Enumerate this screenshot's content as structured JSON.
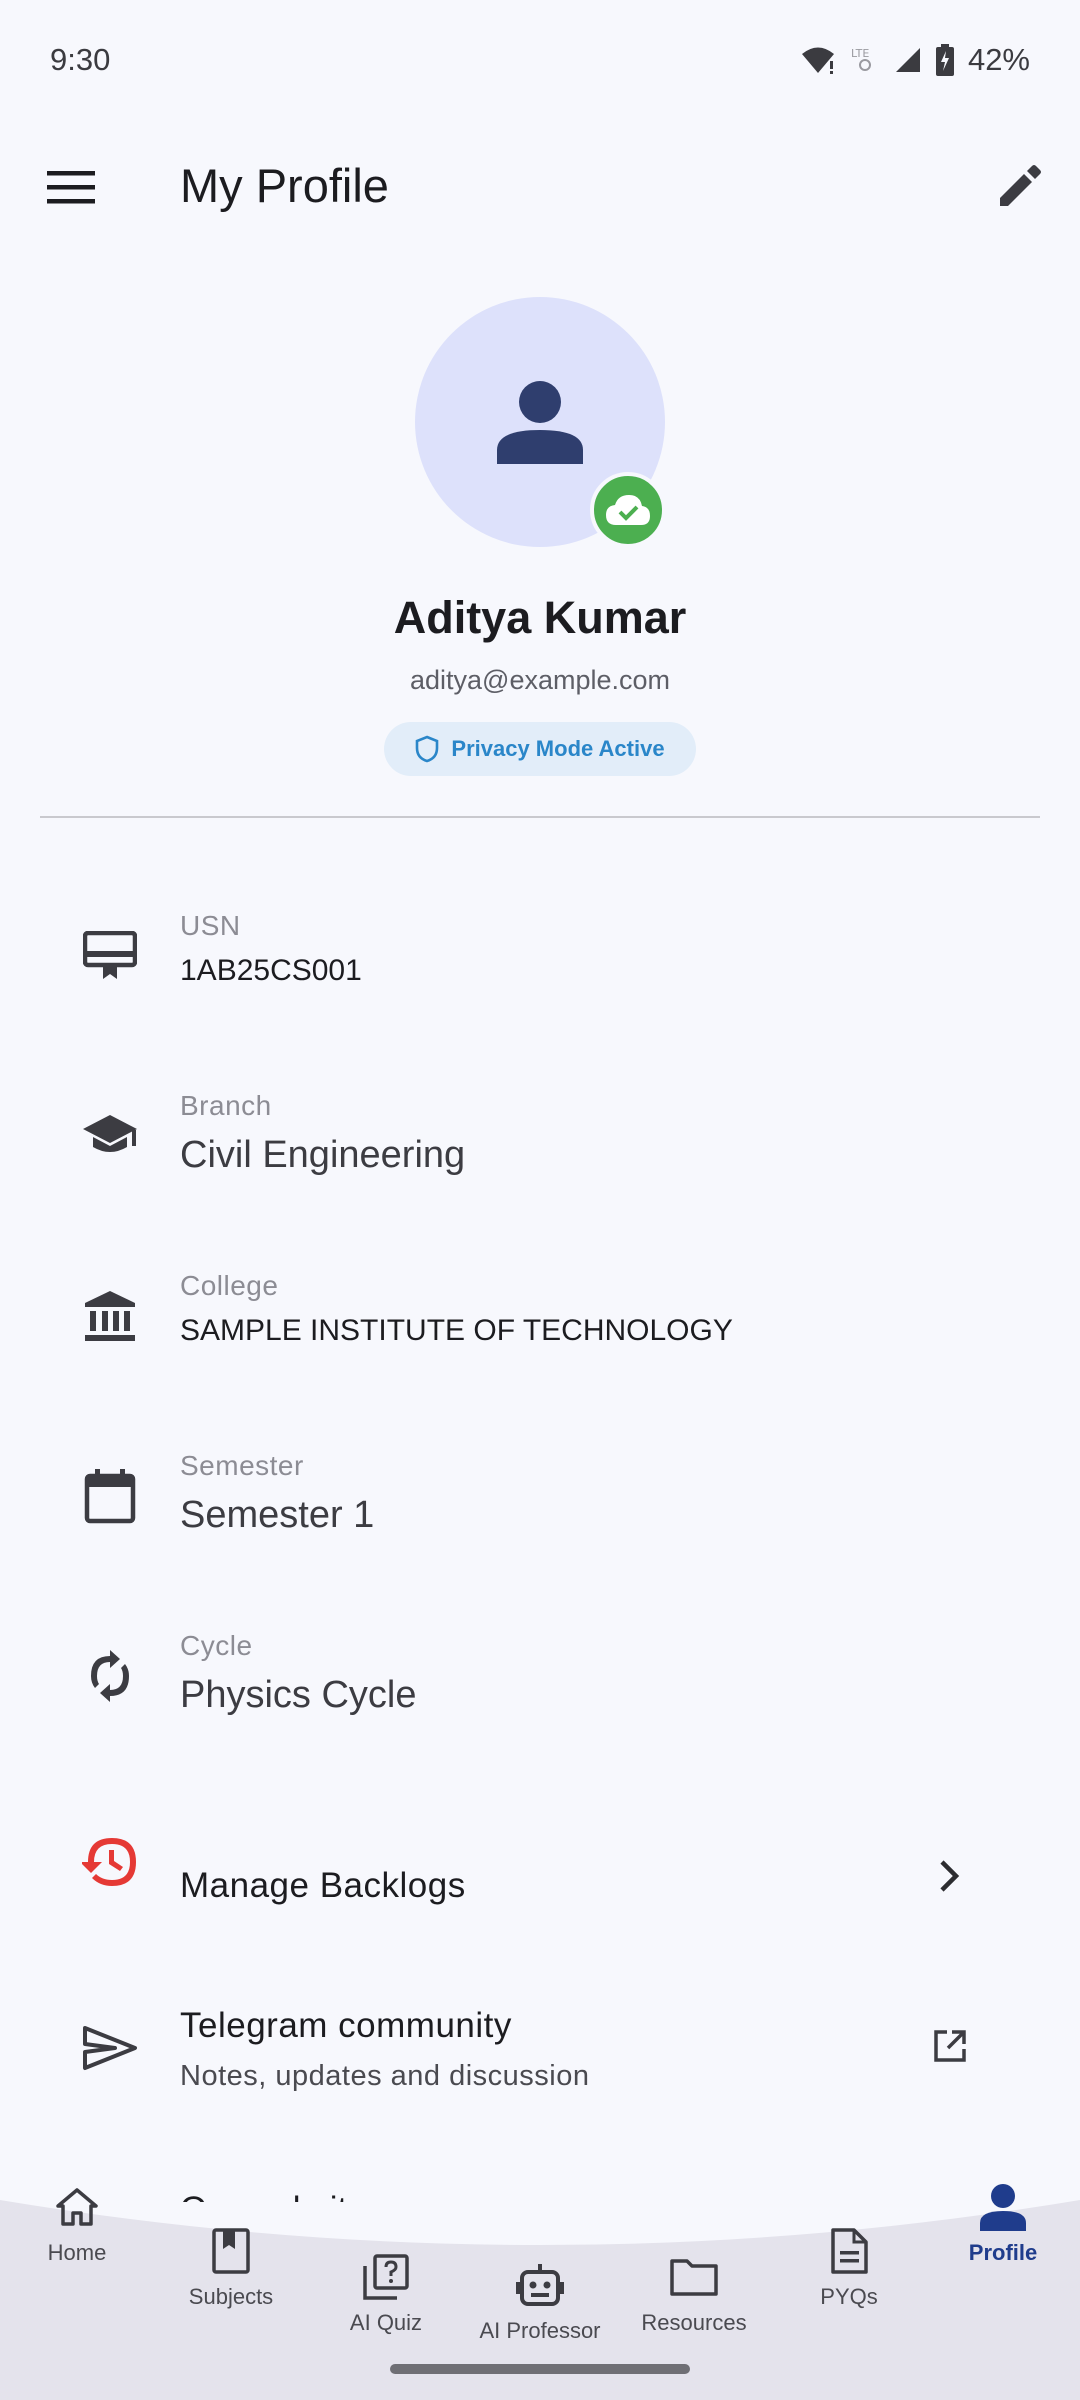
{
  "status_bar": {
    "time": "9:30",
    "battery": "42%",
    "icons": [
      "wifi-icon",
      "lte-icon",
      "signal-icon",
      "battery-charging-icon"
    ]
  },
  "app_bar": {
    "title": "My Profile",
    "menu_icon": "menu-icon",
    "edit_icon": "edit-icon"
  },
  "profile": {
    "name": "Aditya Kumar",
    "email": "aditya@example.com",
    "privacy_badge": "Privacy Mode Active"
  },
  "info": [
    {
      "label": "USN",
      "value": "1AB25CS001",
      "icon": "id-card-icon"
    },
    {
      "label": "Branch",
      "value": "Civil Engineering",
      "icon": "school-icon"
    },
    {
      "label": "College",
      "value": "SAMPLE INSTITUTE OF TECHNOLOGY",
      "icon": "institution-icon"
    },
    {
      "label": "Semester",
      "value": "Semester 1",
      "icon": "calendar-icon"
    },
    {
      "label": "Cycle",
      "value": "Physics Cycle",
      "icon": "sync-icon"
    }
  ],
  "actions": [
    {
      "title": "Manage Backlogs",
      "icon": "history-icon",
      "trail": "chevron-right-icon"
    },
    {
      "title": "Telegram community",
      "subtitle": "Notes, updates and discussion",
      "icon": "send-icon",
      "trail": "open-external-icon"
    },
    {
      "title": "Our website"
    }
  ],
  "nav": [
    {
      "label": "Home",
      "icon": "home-icon"
    },
    {
      "label": "Subjects",
      "icon": "bookmark-book-icon"
    },
    {
      "label": "AI Quiz",
      "icon": "quiz-icon"
    },
    {
      "label": "AI Professor",
      "icon": "robot-icon"
    },
    {
      "label": "Resources",
      "icon": "folder-icon"
    },
    {
      "label": "PYQs",
      "icon": "document-icon"
    },
    {
      "label": "Profile",
      "icon": "person-icon",
      "active": true
    }
  ],
  "colors": {
    "accent": "#1f3c8c",
    "success": "#4caf50",
    "danger": "#e53935",
    "badge_text": "#2a86c9"
  }
}
